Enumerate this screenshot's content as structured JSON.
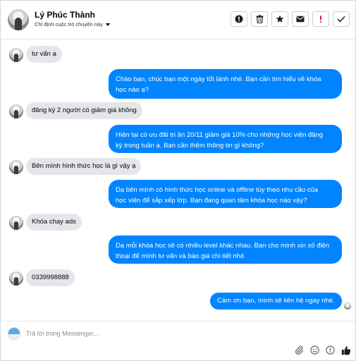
{
  "header": {
    "contact_name": "Lý Phúc Thành",
    "assign_label": "Chỉ định cuộc trò chuyện này",
    "actions": [
      {
        "name": "spam-button",
        "icon": "exclamation-circle-icon"
      },
      {
        "name": "delete-button",
        "icon": "trash-icon"
      },
      {
        "name": "star-button",
        "icon": "star-icon"
      },
      {
        "name": "mark-unread-button",
        "icon": "envelope-icon"
      },
      {
        "name": "flag-button",
        "icon": "red-exclamation-icon"
      },
      {
        "name": "mark-done-button",
        "icon": "check-icon"
      }
    ]
  },
  "messages": [
    {
      "from": "customer",
      "text": "tư vấn ạ"
    },
    {
      "from": "page",
      "lines": [
        "Chào bạn, chúc bạn một ngày tốt lành nhé. Bạn cần tìm hiểu về khóa",
        "học nào ạ?"
      ]
    },
    {
      "from": "customer",
      "text": "đăng ký 2 người có giảm giá không"
    },
    {
      "from": "page",
      "lines": [
        "Hiện tại có ưu đãi tri ân 20/11 giảm giá 10% cho những học viên đăng",
        "ký trong tuần ạ. Bạn cần thêm thông tin gì không?"
      ]
    },
    {
      "from": "customer",
      "text": "Bên mình hình thức học là gì vậy ạ"
    },
    {
      "from": "page",
      "lines": [
        "Dạ bên mình có hình thức học online và offline tùy theo nhu cầu của",
        "học viên để sắp xếp lớp. Bạn đang quan tâm khóa học nào vậy?"
      ]
    },
    {
      "from": "customer",
      "text": "Khóa chạy ads"
    },
    {
      "from": "page",
      "lines": [
        "Dạ mỗi khóa học sẽ có nhiều level khác nhau. Bạn cho mình xin số điện",
        "thoại để mình tư vấn và báo giá chi tiết nhé."
      ]
    },
    {
      "from": "customer",
      "text": "0339998888"
    },
    {
      "from": "page",
      "lines": [
        "Cảm ơn bạn, mình sẽ liên hệ ngay nhé."
      ]
    }
  ],
  "composer": {
    "placeholder": "Trả lời trong Messenger...",
    "value": "",
    "icons": [
      "attachment-icon",
      "emoji-icon",
      "gif-icon",
      "like-thumb-icon"
    ]
  },
  "colors": {
    "outgoing_bubble": "#0084ff",
    "incoming_bubble": "#e4e6eb",
    "flag_red": "#e41e3f"
  }
}
